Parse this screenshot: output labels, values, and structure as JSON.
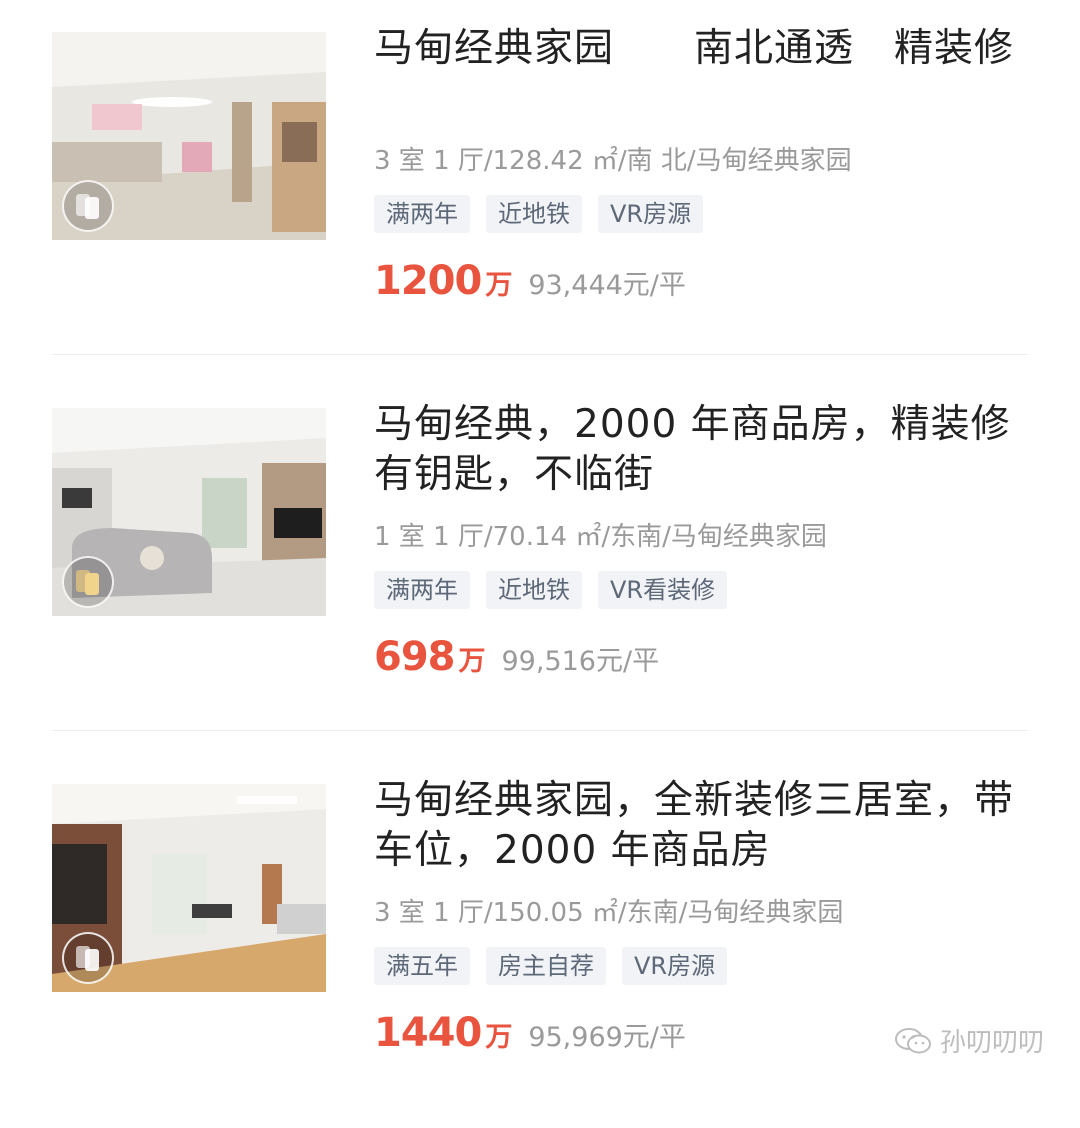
{
  "listings": [
    {
      "title": "马甸经典家园　　南北通透　精装修",
      "meta": "3 室 1 厅/128.42 ㎡/南 北/马甸经典家园",
      "tags": [
        "满两年",
        "近地铁",
        "VR房源"
      ],
      "price": "1200",
      "price_unit": "万",
      "unit_price": "93,444元/平",
      "photo_icon": "vr-tour-icon"
    },
    {
      "title": "马甸经典，2000 年商品房，精装修有钥匙，不临街",
      "meta": "1 室 1 厅/70.14 ㎡/东南/马甸经典家园",
      "tags": [
        "满两年",
        "近地铁",
        "VR看装修"
      ],
      "price": "698",
      "price_unit": "万",
      "unit_price": "99,516元/平",
      "photo_icon": "vr-tour-icon"
    },
    {
      "title": "马甸经典家园，全新装修三居室，带车位，2000 年商品房",
      "meta": "3 室 1 厅/150.05 ㎡/东南/马甸经典家园",
      "tags": [
        "满五年",
        "房主自荐",
        "VR房源"
      ],
      "price": "1440",
      "price_unit": "万",
      "unit_price": "95,969元/平",
      "photo_icon": "vr-tour-icon"
    }
  ],
  "watermark": {
    "text": "孙叨叨叨",
    "icon": "wechat-icon"
  },
  "colors": {
    "price": "#e8543e",
    "tag_bg": "#f1f3f6",
    "tag_text": "#5d6878",
    "meta_text": "#9a9a9a"
  }
}
